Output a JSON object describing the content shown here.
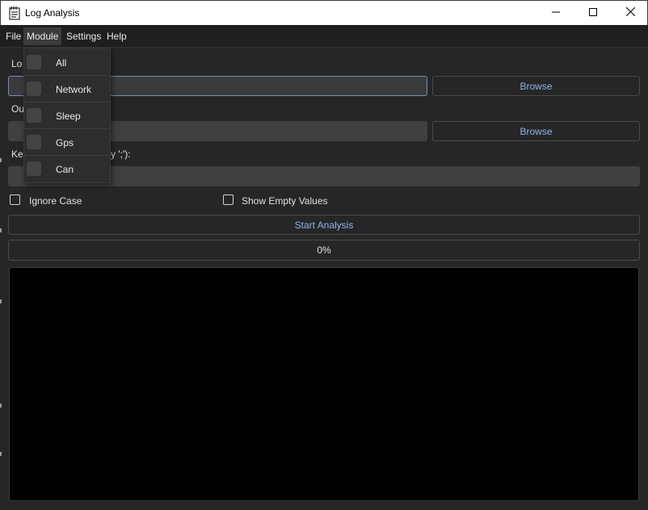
{
  "window": {
    "title": "Log Analysis"
  },
  "menubar": {
    "items": [
      "File",
      "Module",
      "Settings",
      "Help"
    ]
  },
  "module_menu": {
    "items": [
      "All",
      "Network",
      "Sleep",
      "Gps",
      "Can"
    ]
  },
  "form": {
    "log_label": "Lo",
    "log_path_value": "",
    "log_browse": "Browse",
    "output_label": "Ou",
    "output_path_value": "",
    "output_browse": "Browse",
    "keywords_label_left": "Ke",
    "keywords_label_right": "y ';'):",
    "keywords_value": ""
  },
  "options": {
    "ignore_case": {
      "label": "Ignore Case",
      "checked": false
    },
    "show_empty": {
      "label": "Show Empty Values",
      "checked": false
    }
  },
  "actions": {
    "start": "Start Analysis"
  },
  "progress": {
    "text": "0%",
    "value": 0
  },
  "output": {
    "text": ""
  },
  "colors": {
    "accent_text": "#8cb4f0",
    "focus_border": "#6f8fb8"
  },
  "icons": {
    "app": "notepad-icon",
    "minimize": "minimize-icon",
    "maximize": "maximize-icon",
    "close": "close-icon"
  }
}
